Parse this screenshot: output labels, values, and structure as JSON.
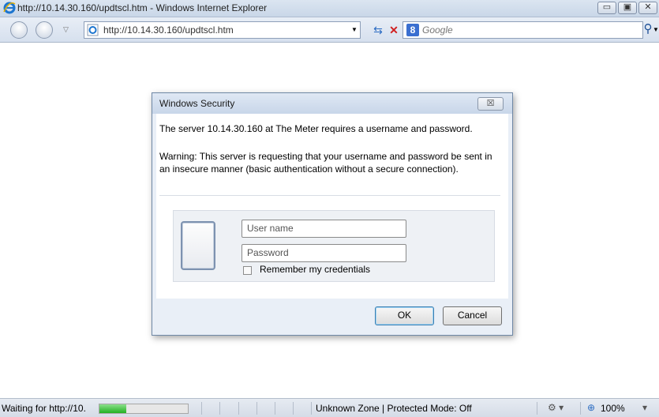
{
  "window": {
    "title": "http://10.14.30.160/updtscl.htm - Windows Internet Explorer",
    "controls": [
      "minimize",
      "maximize",
      "close"
    ]
  },
  "navbar": {
    "address": "http://10.14.30.160/updtscl.htm",
    "search_placeholder": "Google",
    "icons": [
      "back-icon",
      "forward-icon",
      "refresh-icon",
      "stop-icon",
      "search-icon"
    ]
  },
  "dialog": {
    "title": "Windows Security",
    "message": "The server 10.14.30.160 at The Meter requires a username and password.",
    "warning": "Warning: This server is requesting that your username and password be sent in an insecure manner (basic authentication without a secure connection).",
    "username_placeholder": "User name",
    "password_placeholder": "Password",
    "remember_label": "Remember my credentials",
    "remember_checked": false,
    "ok_label": "OK",
    "cancel_label": "Cancel"
  },
  "statusbar": {
    "status_text": "Waiting for http://10.",
    "progress_fraction": 0.3,
    "zone_text": "Unknown Zone | Protected Mode: Off",
    "zoom": "100%"
  },
  "colors": {
    "chrome": "#d6e0ee",
    "dialog_frame": "#6f88a6",
    "progress": "#22b122"
  }
}
